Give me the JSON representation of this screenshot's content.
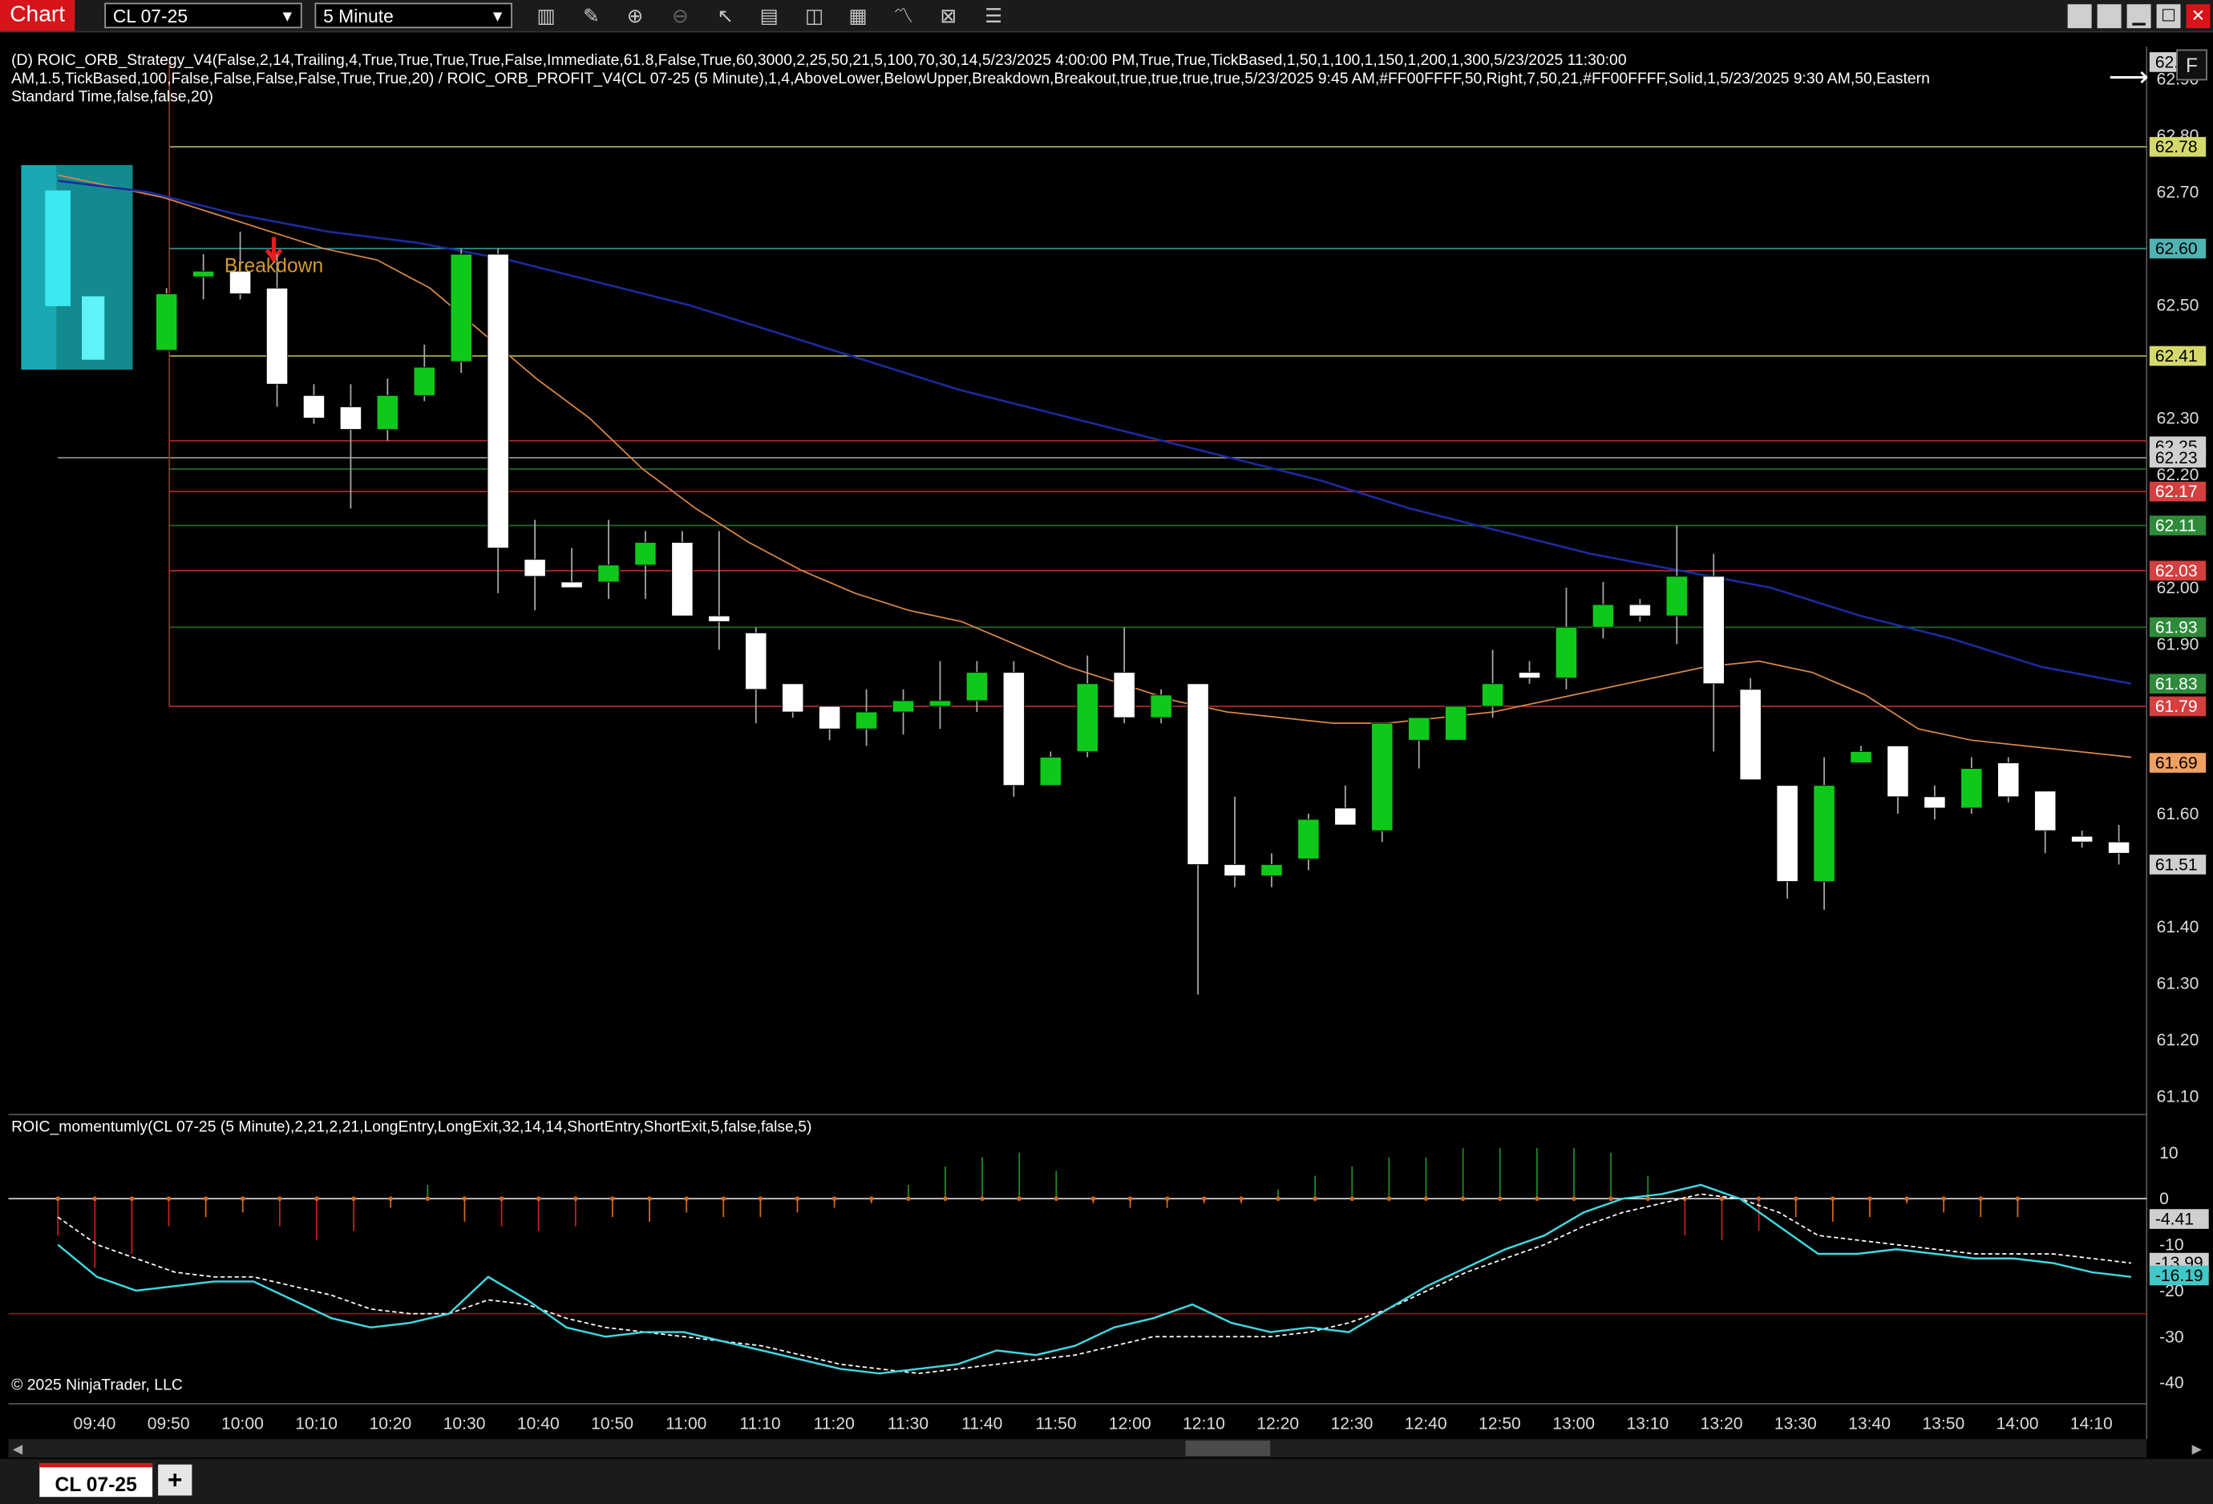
{
  "toolbar": {
    "chart_label": "Chart",
    "instrument": "CL 07-25",
    "interval": "5 Minute",
    "tool_icons": [
      "bar-type-icon",
      "draw-pencil-icon",
      "zoom-in-icon",
      "zoom-out-icon",
      "pointer-icon",
      "properties-icon",
      "data-box-icon",
      "indicators-icon",
      "strategies-icon",
      "trade-icon",
      "list-icon"
    ],
    "window_buttons": [
      "",
      "",
      "▁",
      "☐",
      "✕"
    ]
  },
  "strategy_info": {
    "line1": "(D) ROIC_ORB_Strategy_V4(False,2,14,Trailing,4,True,True,True,True,False,Immediate,61.8,False,True,60,3000,2,25,50,21,5,100,70,30,14,5/23/2025 4:00:00 PM,True,True,TickBased,1,50,1,100,1,150,1,200,1,300,5/23/2025 11:30:00",
    "line2": "AM,1.5,TickBased,100,False,False,False,False,True,True,20) / ROIC_ORB_PROFIT_V4(CL 07-25 (5 Minute),1,4,AboveLower,BelowUpper,Breakdown,Breakout,true,true,true,true,5/23/2025 9:45 AM,#FF00FFFF,50,Right,7,50,21,#FF00FFFF,Solid,1,5/23/2025 9:30 AM,50,Eastern",
    "line3": "Standard Time,false,false,20)"
  },
  "indicator_info": "ROIC_momentumly(CL 07-25 (5 Minute),2,21,2,21,LongEntry,LongExit,32,14,14,ShortEntry,ShortExit,5,false,false,5)",
  "copyright": "© 2025 NinjaTrader, LLC",
  "scale_button": "F",
  "breakdown_label": "Breakdown",
  "tab": {
    "label": "CL 07-25",
    "add": "+"
  },
  "chart_data": {
    "type": "candlestick",
    "instrument": "CL 07-25",
    "interval": "5 Minute",
    "price_axis": {
      "ylim": [
        61.05,
        62.95
      ],
      "ticks": [
        62.9,
        62.8,
        62.7,
        62.5,
        62.3,
        62.2,
        62.0,
        61.9,
        61.6,
        61.4,
        61.3,
        61.2,
        61.1
      ],
      "tick_labels": [
        "62.90",
        "62.80",
        "62.70",
        "62.50",
        "62.30",
        "62.20",
        "62.00",
        "61.90",
        "61.60",
        "61.40",
        "61.30",
        "61.20",
        "61.10"
      ],
      "price_tags": [
        {
          "label": "62.93",
          "value": 62.93,
          "color": "#cfcfcf",
          "text": "#000"
        },
        {
          "label": "62.78",
          "value": 62.78,
          "color": "#d4d96a",
          "text": "#000"
        },
        {
          "label": "62.60",
          "value": 62.6,
          "color": "#4fb3b3",
          "text": "#000"
        },
        {
          "label": "62.41",
          "value": 62.41,
          "color": "#d4d96a",
          "text": "#000"
        },
        {
          "label": "62.25",
          "value": 62.25,
          "color": "#cfcfcf",
          "text": "#000"
        },
        {
          "label": "62.23",
          "value": 62.23,
          "color": "#cfcfcf",
          "text": "#000"
        },
        {
          "label": "62.17",
          "value": 62.17,
          "color": "#d44040",
          "text": "#fff"
        },
        {
          "label": "62.11",
          "value": 62.11,
          "color": "#2e8b3a",
          "text": "#fff"
        },
        {
          "label": "62.03",
          "value": 62.03,
          "color": "#d44040",
          "text": "#fff"
        },
        {
          "label": "61.93",
          "value": 61.93,
          "color": "#2e8b3a",
          "text": "#fff"
        },
        {
          "label": "61.83",
          "value": 61.83,
          "color": "#2e8b3a",
          "text": "#fff"
        },
        {
          "label": "61.79",
          "value": 61.79,
          "color": "#d44040",
          "text": "#fff"
        },
        {
          "label": "61.69",
          "value": 61.69,
          "color": "#f0a060",
          "text": "#000"
        },
        {
          "label": "61.51",
          "value": 61.51,
          "color": "#cfcfcf",
          "text": "#000"
        }
      ]
    },
    "time_labels": [
      "09:40",
      "09:50",
      "10:00",
      "10:10",
      "10:20",
      "10:30",
      "10:40",
      "10:50",
      "11:00",
      "11:10",
      "11:20",
      "11:30",
      "11:40",
      "11:50",
      "12:00",
      "12:10",
      "12:20",
      "12:30",
      "12:40",
      "12:50",
      "13:00",
      "13:10",
      "13:20",
      "13:30",
      "13:40",
      "13:50",
      "14:00",
      "14:10"
    ],
    "levels": [
      {
        "value": 62.78,
        "color": "#a8ad4a"
      },
      {
        "value": 62.6,
        "color": "#2f8f8f"
      },
      {
        "value": 62.41,
        "color": "#a8ad4a"
      },
      {
        "value": 62.26,
        "color": "#aa2a2a"
      },
      {
        "value": 62.23,
        "color": "#888888"
      },
      {
        "value": 62.21,
        "color": "#1f6b2a"
      },
      {
        "value": 62.17,
        "color": "#aa2a2a"
      },
      {
        "value": 62.11,
        "color": "#1f6b2a"
      },
      {
        "value": 62.03,
        "color": "#aa2a2a"
      },
      {
        "value": 61.93,
        "color": "#1f6b2a"
      },
      {
        "value": 61.79,
        "color": "#aa2a2a"
      }
    ],
    "candles": [
      {
        "t": "09:45",
        "o": 62.42,
        "h": 62.53,
        "l": 62.42,
        "c": 62.52
      },
      {
        "t": "09:50",
        "o": 62.55,
        "h": 62.59,
        "l": 62.51,
        "c": 62.56
      },
      {
        "t": "09:55",
        "o": 62.56,
        "h": 62.63,
        "l": 62.51,
        "c": 62.52
      },
      {
        "t": "10:00",
        "o": 62.53,
        "h": 62.59,
        "l": 62.32,
        "c": 62.36
      },
      {
        "t": "10:05",
        "o": 62.34,
        "h": 62.36,
        "l": 62.29,
        "c": 62.3
      },
      {
        "t": "10:10",
        "o": 62.32,
        "h": 62.36,
        "l": 62.14,
        "c": 62.28
      },
      {
        "t": "10:15",
        "o": 62.28,
        "h": 62.37,
        "l": 62.26,
        "c": 62.34
      },
      {
        "t": "10:20",
        "o": 62.34,
        "h": 62.43,
        "l": 62.33,
        "c": 62.39
      },
      {
        "t": "10:25",
        "o": 62.4,
        "h": 62.6,
        "l": 62.38,
        "c": 62.59
      },
      {
        "t": "10:30",
        "o": 62.59,
        "h": 62.6,
        "l": 61.99,
        "c": 62.07
      },
      {
        "t": "10:35",
        "o": 62.05,
        "h": 62.12,
        "l": 61.96,
        "c": 62.02
      },
      {
        "t": "10:40",
        "o": 62.01,
        "h": 62.07,
        "l": 62.0,
        "c": 62.0
      },
      {
        "t": "10:45",
        "o": 62.01,
        "h": 62.12,
        "l": 61.98,
        "c": 62.04
      },
      {
        "t": "10:50",
        "o": 62.04,
        "h": 62.1,
        "l": 61.98,
        "c": 62.08
      },
      {
        "t": "10:55",
        "o": 62.08,
        "h": 62.1,
        "l": 61.95,
        "c": 61.95
      },
      {
        "t": "11:00",
        "o": 61.95,
        "h": 62.1,
        "l": 61.89,
        "c": 61.94
      },
      {
        "t": "11:05",
        "o": 61.92,
        "h": 61.93,
        "l": 61.76,
        "c": 61.82
      },
      {
        "t": "11:10",
        "o": 61.83,
        "h": 61.83,
        "l": 61.77,
        "c": 61.78
      },
      {
        "t": "11:15",
        "o": 61.79,
        "h": 61.79,
        "l": 61.73,
        "c": 61.75
      },
      {
        "t": "11:20",
        "o": 61.75,
        "h": 61.82,
        "l": 61.72,
        "c": 61.78
      },
      {
        "t": "11:25",
        "o": 61.78,
        "h": 61.82,
        "l": 61.74,
        "c": 61.8
      },
      {
        "t": "11:30",
        "o": 61.79,
        "h": 61.87,
        "l": 61.75,
        "c": 61.8
      },
      {
        "t": "11:35",
        "o": 61.8,
        "h": 61.87,
        "l": 61.78,
        "c": 61.85
      },
      {
        "t": "11:40",
        "o": 61.85,
        "h": 61.87,
        "l": 61.63,
        "c": 61.65
      },
      {
        "t": "11:45",
        "o": 61.65,
        "h": 61.71,
        "l": 61.65,
        "c": 61.7
      },
      {
        "t": "11:50",
        "o": 61.71,
        "h": 61.88,
        "l": 61.7,
        "c": 61.83
      },
      {
        "t": "11:55",
        "o": 61.85,
        "h": 61.93,
        "l": 61.76,
        "c": 61.77
      },
      {
        "t": "12:00",
        "o": 61.77,
        "h": 61.82,
        "l": 61.76,
        "c": 61.81
      },
      {
        "t": "12:05",
        "o": 61.83,
        "h": 61.83,
        "l": 61.28,
        "c": 61.51
      },
      {
        "t": "12:10",
        "o": 61.51,
        "h": 61.63,
        "l": 61.47,
        "c": 61.49
      },
      {
        "t": "12:15",
        "o": 61.49,
        "h": 61.53,
        "l": 61.47,
        "c": 61.51
      },
      {
        "t": "12:20",
        "o": 61.52,
        "h": 61.6,
        "l": 61.5,
        "c": 61.59
      },
      {
        "t": "12:25",
        "o": 61.61,
        "h": 61.65,
        "l": 61.58,
        "c": 61.58
      },
      {
        "t": "12:30",
        "o": 61.57,
        "h": 61.76,
        "l": 61.55,
        "c": 61.76
      },
      {
        "t": "12:35",
        "o": 61.73,
        "h": 61.76,
        "l": 61.68,
        "c": 61.77
      },
      {
        "t": "12:40",
        "o": 61.73,
        "h": 61.79,
        "l": 61.73,
        "c": 61.79
      },
      {
        "t": "12:45",
        "o": 61.79,
        "h": 61.89,
        "l": 61.77,
        "c": 61.83
      },
      {
        "t": "12:50",
        "o": 61.85,
        "h": 61.87,
        "l": 61.83,
        "c": 61.84
      },
      {
        "t": "12:55",
        "o": 61.84,
        "h": 62.0,
        "l": 61.82,
        "c": 61.93
      },
      {
        "t": "13:00",
        "o": 61.93,
        "h": 62.01,
        "l": 61.91,
        "c": 61.97
      },
      {
        "t": "13:05",
        "o": 61.97,
        "h": 61.98,
        "l": 61.94,
        "c": 61.95
      },
      {
        "t": "13:10",
        "o": 61.95,
        "h": 62.11,
        "l": 61.9,
        "c": 62.02
      },
      {
        "t": "13:15",
        "o": 62.02,
        "h": 62.06,
        "l": 61.71,
        "c": 61.83
      },
      {
        "t": "13:20",
        "o": 61.82,
        "h": 61.84,
        "l": 61.66,
        "c": 61.66
      },
      {
        "t": "13:25",
        "o": 61.65,
        "h": 61.65,
        "l": 61.45,
        "c": 61.48
      },
      {
        "t": "13:30",
        "o": 61.48,
        "h": 61.7,
        "l": 61.43,
        "c": 61.65
      },
      {
        "t": "13:35",
        "o": 61.69,
        "h": 61.72,
        "l": 61.69,
        "c": 61.71
      },
      {
        "t": "13:40",
        "o": 61.72,
        "h": 61.72,
        "l": 61.6,
        "c": 61.63
      },
      {
        "t": "13:45",
        "o": 61.63,
        "h": 61.65,
        "l": 61.59,
        "c": 61.61
      },
      {
        "t": "13:50",
        "o": 61.61,
        "h": 61.7,
        "l": 61.6,
        "c": 61.68
      },
      {
        "t": "13:55",
        "o": 61.69,
        "h": 61.7,
        "l": 61.62,
        "c": 61.63
      },
      {
        "t": "14:00",
        "o": 61.64,
        "h": 61.64,
        "l": 61.53,
        "c": 61.57
      },
      {
        "t": "14:05",
        "o": 61.56,
        "h": 61.57,
        "l": 61.54,
        "c": 61.55
      },
      {
        "t": "14:10",
        "o": 61.55,
        "h": 61.58,
        "l": 61.51,
        "c": 61.53
      }
    ],
    "ema_fast": [
      62.73,
      62.71,
      62.69,
      62.66,
      62.63,
      62.6,
      62.58,
      62.53,
      62.45,
      62.37,
      62.3,
      62.21,
      62.14,
      62.08,
      62.03,
      61.99,
      61.96,
      61.94,
      61.9,
      61.86,
      61.83,
      61.8,
      61.78,
      61.77,
      61.76,
      61.76,
      61.77,
      61.78,
      61.8,
      61.82,
      61.84,
      61.86,
      61.87,
      61.85,
      61.81,
      61.75,
      61.73,
      61.72,
      61.71,
      61.7
    ],
    "ema_slow": [
      62.72,
      62.7,
      62.66,
      62.63,
      62.61,
      62.58,
      62.54,
      62.5,
      62.45,
      62.4,
      62.35,
      62.31,
      62.27,
      62.23,
      62.19,
      62.14,
      62.1,
      62.06,
      62.03,
      62.0,
      61.95,
      61.91,
      61.86,
      61.83
    ],
    "oscillator": {
      "ylim": [
        -43,
        15
      ],
      "ticks": [
        10,
        0,
        -10,
        -20,
        -30,
        -40
      ],
      "tick_labels": [
        "10",
        "0",
        "-10",
        "-20",
        "-30",
        "-40"
      ],
      "value_tags": [
        {
          "label": "-4.41",
          "value": -4.41,
          "color": "#cfcfcf"
        },
        {
          "label": "-13.99",
          "value": -13.99,
          "color": "#cfcfcf"
        },
        {
          "label": "-16.19",
          "value": -16.19,
          "color": "#40c8c8"
        }
      ],
      "threshold_lines": [
        0,
        -25
      ],
      "fast_line": [
        -10,
        -17,
        -20,
        -19,
        -18,
        -18,
        -22,
        -26,
        -28,
        -27,
        -25,
        -17,
        -22,
        -28,
        -30,
        -29,
        -29,
        -31,
        -33,
        -35,
        -37,
        -38,
        -37,
        -36,
        -33,
        -34,
        -32,
        -28,
        -26,
        -23,
        -27,
        -29,
        -28,
        -29,
        -24,
        -19,
        -15,
        -11,
        -8,
        -3,
        0,
        1,
        3,
        0,
        -6,
        -12,
        -12,
        -11,
        -12,
        -13,
        -13,
        -14,
        -16,
        -17
      ],
      "slow_line": [
        -4,
        -10,
        -13,
        -16,
        -17,
        -17,
        -19,
        -21,
        -24,
        -25,
        -25,
        -22,
        -23,
        -26,
        -28,
        -29,
        -30,
        -31,
        -32,
        -34,
        -36,
        -37,
        -38,
        -37,
        -36,
        -35,
        -34,
        -32,
        -30,
        -30,
        -30,
        -30,
        -29,
        -27,
        -24,
        -20,
        -16,
        -13,
        -10,
        -6,
        -3,
        -1,
        1,
        0,
        -3,
        -8,
        -9,
        -10,
        -11,
        -12,
        -12,
        -12,
        -13,
        -14
      ],
      "histogram": [
        -8,
        -15,
        -12,
        -6,
        -4,
        -3,
        -6,
        -9,
        -7,
        -2,
        3,
        -5,
        -6,
        -7,
        -6,
        -4,
        -5,
        -3,
        -4,
        -4,
        -3,
        -2,
        -1,
        3,
        7,
        9,
        10,
        6,
        -1,
        -2,
        -2,
        -1,
        -1,
        2,
        5,
        7,
        9,
        9,
        11,
        11,
        11,
        11,
        10,
        5,
        -8,
        -9,
        -7,
        -4,
        -5,
        -4,
        -1,
        -3,
        -4,
        -4
      ],
      "lower_threshold": -25
    },
    "orb_box": {
      "top": 62.78,
      "bottom": 62.41
    },
    "breakdown_marker_time": "10:00"
  }
}
